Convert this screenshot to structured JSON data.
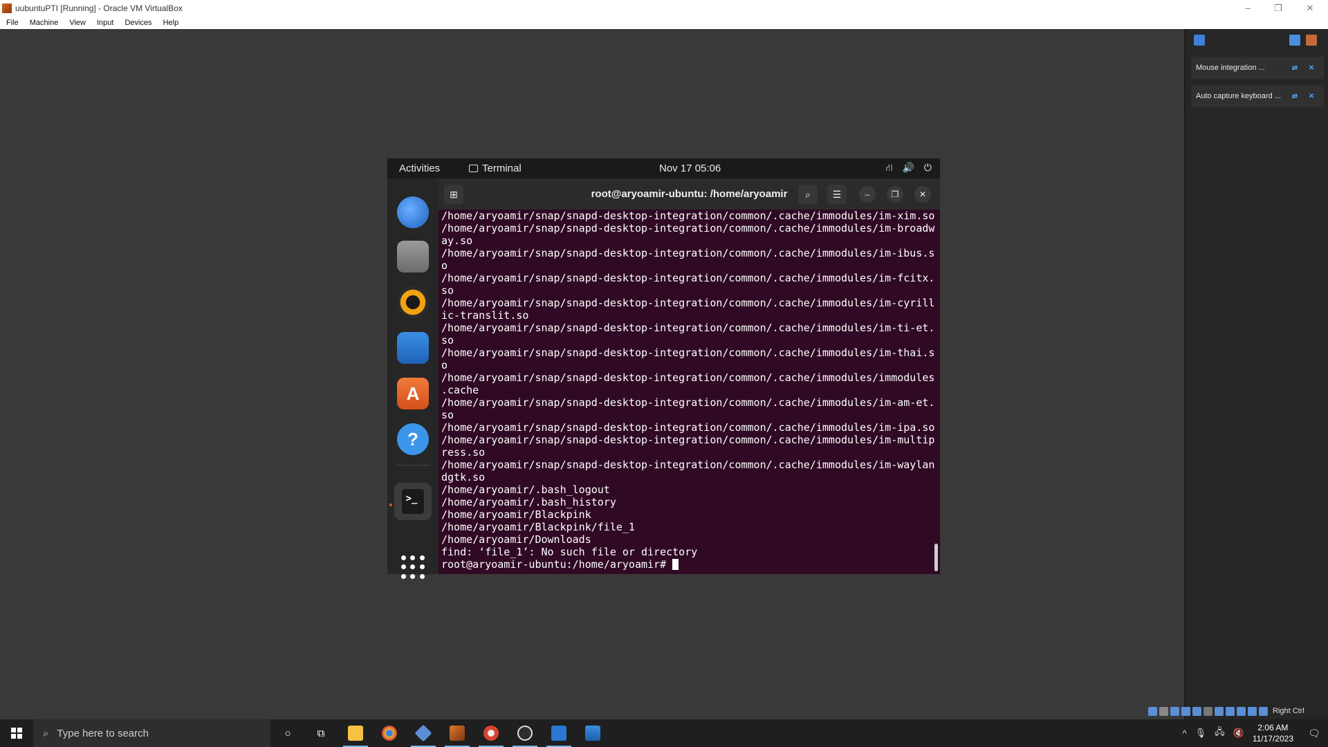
{
  "host": {
    "title": "uubuntuPTI [Running] - Oracle VM VirtualBox",
    "menu": [
      "File",
      "Machine",
      "View",
      "Input",
      "Devices",
      "Help"
    ],
    "controls": {
      "minimize": "–",
      "restore": "❐",
      "close": "✕"
    }
  },
  "panel": {
    "notifications": [
      {
        "text": "Mouse integration ..."
      },
      {
        "text": "Auto capture keyboard ..."
      }
    ],
    "hostkey": "Right Ctrl"
  },
  "gnome": {
    "activities": "Activities",
    "app": "Terminal",
    "clock": "Nov 17  05:06",
    "tray": [
      "network-icon",
      "volume-icon",
      "power-icon"
    ]
  },
  "dock": {
    "apps": [
      "thunderbird-icon",
      "files-icon",
      "rhythmbox-icon",
      "writer-icon",
      "software-icon",
      "help-icon",
      "terminal-icon"
    ],
    "help_glyph": "?",
    "software_glyph": "A",
    "terminal_glyph": ">_"
  },
  "terminal": {
    "title": "root@aryoamir-ubuntu: /home/aryoamir",
    "lines": [
      "/home/aryoamir/snap/snapd-desktop-integration/common/.cache/immodules/im-xim.so",
      "/home/aryoamir/snap/snapd-desktop-integration/common/.cache/immodules/im-broadw",
      "ay.so",
      "/home/aryoamir/snap/snapd-desktop-integration/common/.cache/immodules/im-ibus.s",
      "o",
      "/home/aryoamir/snap/snapd-desktop-integration/common/.cache/immodules/im-fcitx.",
      "so",
      "/home/aryoamir/snap/snapd-desktop-integration/common/.cache/immodules/im-cyrill",
      "ic-translit.so",
      "/home/aryoamir/snap/snapd-desktop-integration/common/.cache/immodules/im-ti-et.",
      "so",
      "/home/aryoamir/snap/snapd-desktop-integration/common/.cache/immodules/im-thai.s",
      "o",
      "/home/aryoamir/snap/snapd-desktop-integration/common/.cache/immodules/immodules",
      ".cache",
      "/home/aryoamir/snap/snapd-desktop-integration/common/.cache/immodules/im-am-et.",
      "so",
      "/home/aryoamir/snap/snapd-desktop-integration/common/.cache/immodules/im-ipa.so",
      "/home/aryoamir/snap/snapd-desktop-integration/common/.cache/immodules/im-multip",
      "ress.so",
      "/home/aryoamir/snap/snapd-desktop-integration/common/.cache/immodules/im-waylan",
      "dgtk.so",
      "/home/aryoamir/.bash_logout",
      "/home/aryoamir/.bash_history",
      "/home/aryoamir/Blackpink",
      "/home/aryoamir/Blackpink/file_1",
      "/home/aryoamir/Downloads",
      "find: ‘file_1’: No such file or directory"
    ],
    "prompt": "root@aryoamir-ubuntu:/home/aryoamir# "
  },
  "taskbar": {
    "search_placeholder": "Type here to search",
    "time": "2:06 AM",
    "date": "11/17/2023"
  },
  "colors": {
    "terminal_bg": "#300a24",
    "ubuntu_orange": "#e95420",
    "taskbar_bg": "#1f1f1f"
  }
}
